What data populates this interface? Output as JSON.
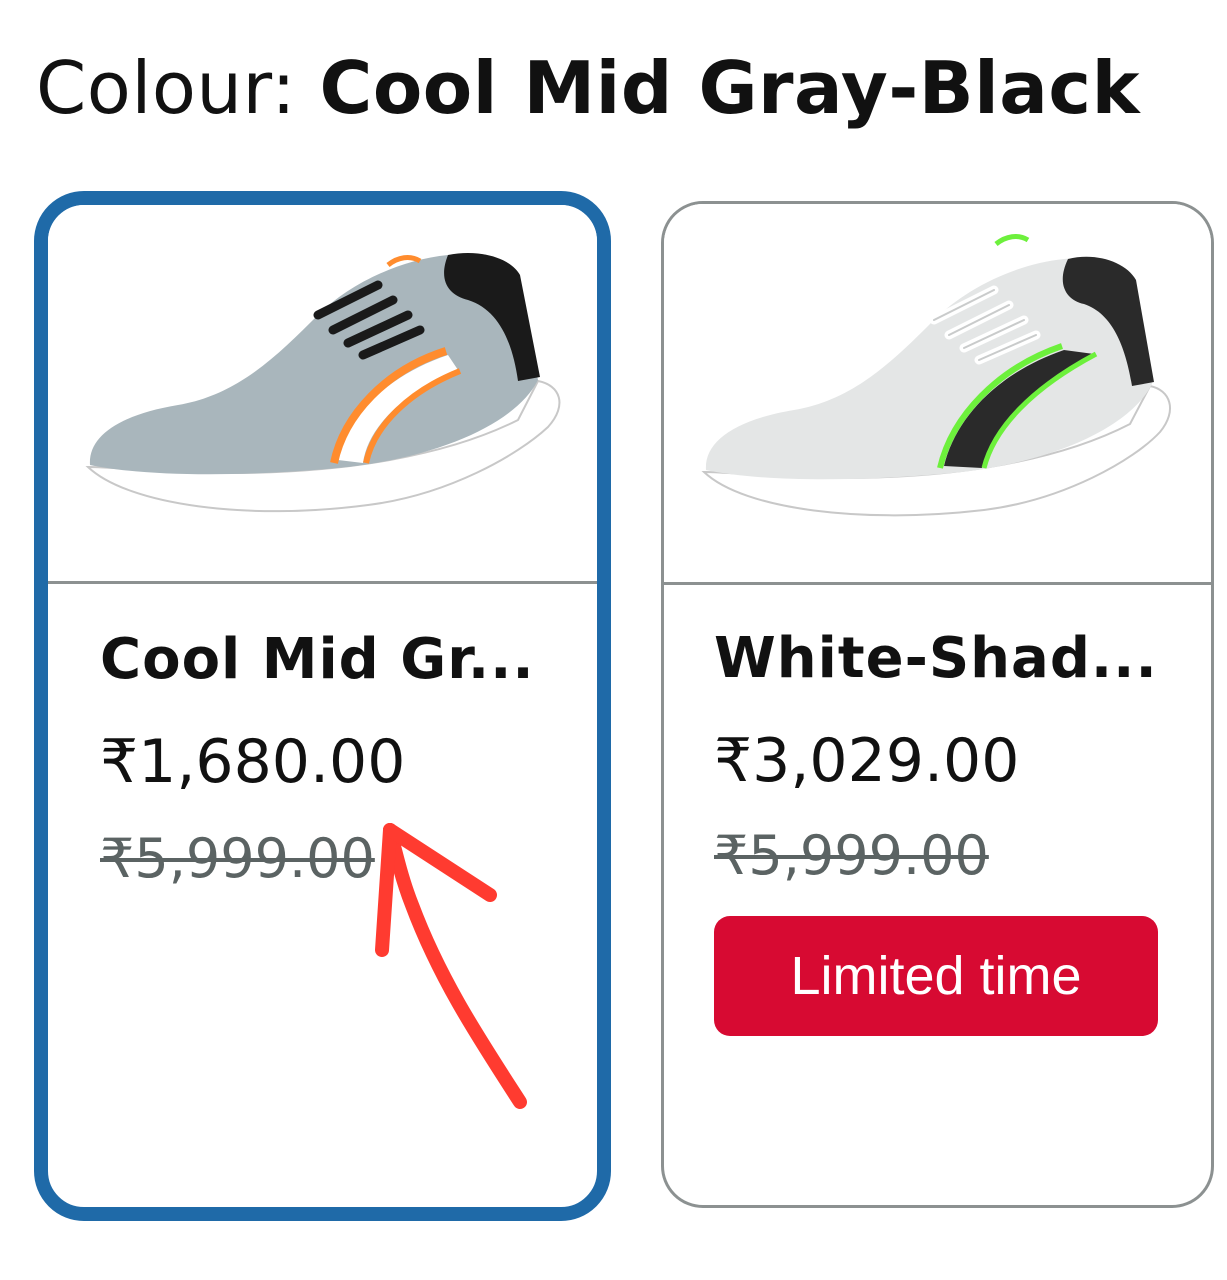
{
  "colour_selector": {
    "label": "Colour: ",
    "selected_value": "Cool Mid Gray-Black"
  },
  "variants": [
    {
      "title": "Cool Mid Gr...",
      "price": "₹1,680.00",
      "mrp": "₹5,999.00",
      "selected": true,
      "shoe_colors": {
        "upper": "#a9b6bc",
        "accent": "#ff8c2e",
        "collar": "#1a1a1a",
        "sole": "#ffffff"
      }
    },
    {
      "title": "White-Shad...",
      "price": "₹3,029.00",
      "mrp": "₹5,999.00",
      "badge": "Limited time",
      "selected": false,
      "shoe_colors": {
        "upper": "#e4e6e6",
        "accent": "#6df03c",
        "collar": "#2a2a2a",
        "sole": "#ffffff"
      }
    }
  ],
  "colors": {
    "selected_border": "#1f6aa8",
    "card_border": "#8c9191",
    "badge_bg": "#d70a32",
    "annotation_arrow": "#ff3b30"
  }
}
